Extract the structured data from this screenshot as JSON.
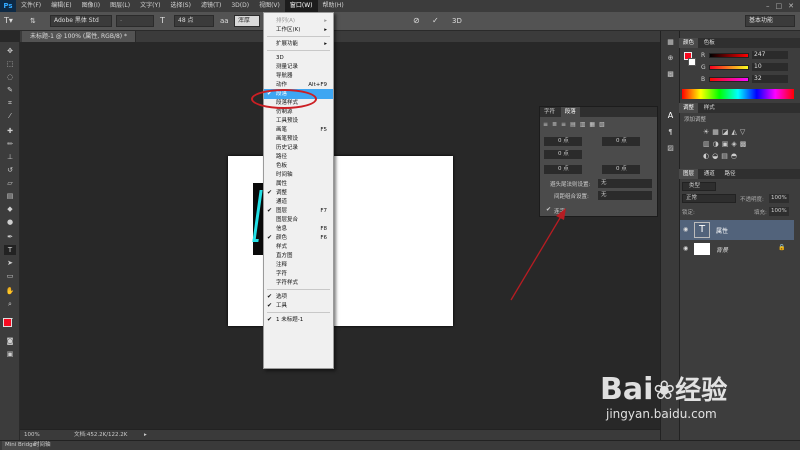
{
  "menubar": {
    "logo": "Ps",
    "items": [
      "文件(F)",
      "编辑(E)",
      "图像(I)",
      "图层(L)",
      "文字(Y)",
      "选择(S)",
      "滤镜(T)",
      "3D(D)",
      "视图(V)",
      "窗口(W)",
      "帮助(H)"
    ],
    "active_index": 9,
    "window_buttons": [
      "–",
      "□",
      "✕"
    ]
  },
  "options": {
    "font_family": "Adobe 黑体 Std",
    "font_style": "-",
    "font_size": "48 点",
    "antialias": "浑厚",
    "workspace": "基本功能"
  },
  "document": {
    "tab": "未标题-1 @ 100% (属性, RGB/8) *",
    "zoom": "100%",
    "doc_size": "文档:452.2K/122.2K"
  },
  "bottom": {
    "mini_bridge": "Mini Bridge",
    "timeline": "时间轴"
  },
  "window_menu": {
    "items": [
      {
        "label": "排列(A)",
        "arrow": "▸",
        "disabled": true
      },
      {
        "label": "工作区(K)",
        "arrow": "▸"
      },
      {
        "sep": true
      },
      {
        "label": "扩展功能",
        "arrow": "▸"
      },
      {
        "sep": true
      },
      {
        "label": "3D"
      },
      {
        "label": "测量记录"
      },
      {
        "label": "导航器"
      },
      {
        "label": "动作",
        "shortcut": "Alt+F9"
      },
      {
        "label": "段落",
        "checked": true,
        "highlight": true
      },
      {
        "label": "段落样式"
      },
      {
        "label": "仿制源"
      },
      {
        "label": "工具预设"
      },
      {
        "label": "画笔",
        "shortcut": "F5"
      },
      {
        "label": "画笔预设"
      },
      {
        "label": "历史记录"
      },
      {
        "label": "路径"
      },
      {
        "label": "色板"
      },
      {
        "label": "时间轴"
      },
      {
        "label": "属性"
      },
      {
        "label": "调整",
        "checked": true
      },
      {
        "label": "通道"
      },
      {
        "label": "图层",
        "checked": true,
        "shortcut": "F7"
      },
      {
        "label": "图层复合"
      },
      {
        "label": "信息",
        "shortcut": "F8"
      },
      {
        "label": "颜色",
        "checked": true,
        "shortcut": "F6"
      },
      {
        "label": "样式"
      },
      {
        "label": "直方图"
      },
      {
        "label": "注释"
      },
      {
        "label": "字符"
      },
      {
        "label": "字符样式"
      },
      {
        "sep": true
      },
      {
        "label": "选项",
        "checked": true
      },
      {
        "label": "工具",
        "checked": true
      },
      {
        "sep": true
      },
      {
        "label": "1 未标题-1",
        "checked": true
      }
    ]
  },
  "color_panel": {
    "tabs": [
      "颜色",
      "色板"
    ],
    "r_label": "R",
    "r": "247",
    "g_label": "G",
    "g": "10",
    "b_label": "B",
    "b": "32"
  },
  "adjust_panel": {
    "tabs": [
      "调整",
      "样式"
    ],
    "hint": "添加调整"
  },
  "layers_panel": {
    "tabs": [
      "图层",
      "通道",
      "路径"
    ],
    "kind": "类型",
    "blend": "正常",
    "opacity_label": "不透明度:",
    "opacity": "100%",
    "lock_label": "锁定:",
    "fill_label": "填充:",
    "fill": "100%",
    "layers": [
      {
        "name": "属性",
        "type": "text",
        "selected": true
      },
      {
        "name": "背景",
        "type": "background"
      }
    ]
  },
  "char_panel": {
    "tabs": [
      "字符",
      "段落"
    ],
    "fields": [
      "0 点",
      "0 点",
      "0 点",
      "0 点",
      "0 点"
    ],
    "avoid_label": "避头尾法则设置:",
    "avoid_value": "无",
    "spacing_label": "间距组合设置:",
    "spacing_value": "无",
    "hyphen_label": "连字"
  },
  "watermark": {
    "brand_pre": "Bai",
    "brand_post": "经验",
    "url": "jingyan.baidu.com"
  },
  "colors": {
    "foreground": "#f70a20",
    "accent": "#3ea6f2",
    "annotation": "#cc1f24"
  }
}
